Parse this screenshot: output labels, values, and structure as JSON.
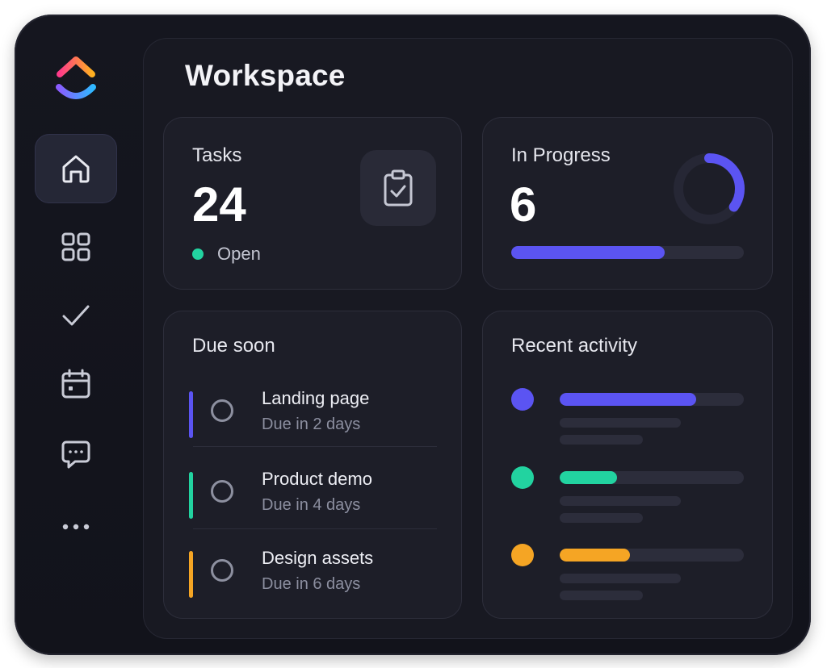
{
  "app": {
    "accent": "#5b54f2",
    "background": "#12131b"
  },
  "sidebar": {
    "logo": "clickup-logo-icon",
    "items": [
      {
        "icon": "home-icon",
        "active": true
      },
      {
        "icon": "grid-icon",
        "active": false
      },
      {
        "icon": "check-icon",
        "active": false
      },
      {
        "icon": "calendar-icon",
        "active": false
      },
      {
        "icon": "chat-icon",
        "active": false
      },
      {
        "icon": "more-icon",
        "active": false
      }
    ]
  },
  "main": {
    "title": "Workspace"
  },
  "tasks_card": {
    "title": "Tasks",
    "count": "24",
    "status_label": "Open",
    "status_color": "#22d3a0",
    "icon": "clipboard-check-icon"
  },
  "progress_card": {
    "title": "In Progress",
    "count": "6",
    "progress_fraction": 0.66,
    "ring_fraction": 0.35,
    "color": "#5b54f2"
  },
  "due_soon": {
    "title": "Due soon",
    "items": [
      {
        "name": "Landing page",
        "due": "Due in 2 days",
        "color": "#5b54f2"
      },
      {
        "name": "Product demo",
        "due": "Due in 4 days",
        "color": "#22d3a0"
      },
      {
        "name": "Design assets",
        "due": "Due in 6 days",
        "color": "#f5a524"
      }
    ]
  },
  "recent_activity": {
    "title": "Recent activity",
    "items": [
      {
        "color": "#5b54f2",
        "fraction": 0.74
      },
      {
        "color": "#22d3a0",
        "fraction": 0.31
      },
      {
        "color": "#f5a524",
        "fraction": 0.38
      }
    ]
  }
}
